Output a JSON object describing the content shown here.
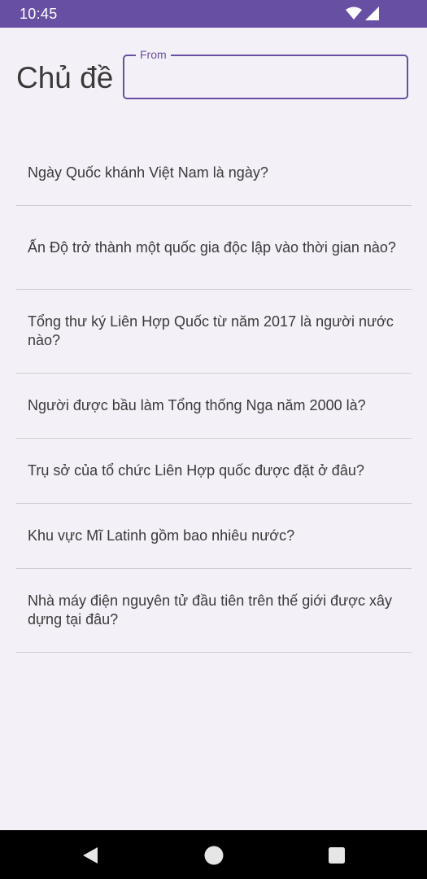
{
  "status_bar": {
    "time": "10:45",
    "icons": [
      "wifi-icon",
      "cellular-signal-icon"
    ]
  },
  "header": {
    "title": "Chủ đề",
    "from_field": {
      "label": "From",
      "value": "",
      "placeholder": ""
    }
  },
  "questions": [
    {
      "text": "Ngày Quốc khánh Việt Nam là ngày?"
    },
    {
      "text": "Ấn Độ trở thành một quốc gia độc lập vào thời gian nào?"
    },
    {
      "text": "Tổng thư ký Liên Hợp Quốc từ năm 2017 là người nước nào?"
    },
    {
      "text": "Người được bầu làm Tổng thống Nga năm 2000 là?"
    },
    {
      "text": "Trụ sở của tổ chức Liên Hợp quốc được đặt ở đâu?"
    },
    {
      "text": "Khu vực Mĩ Latinh gồm bao nhiêu nước?"
    },
    {
      "text": "Nhà máy điện nguyên tử đầu tiên trên thế giới được xây dựng tại đâu?"
    }
  ],
  "navigation": {
    "buttons": [
      "back-icon",
      "home-icon",
      "recents-icon"
    ]
  },
  "colors": {
    "primary": "#6750a4",
    "background": "#f4f0f7",
    "text": "#3a3a3a",
    "divider": "#d0cdd2"
  }
}
